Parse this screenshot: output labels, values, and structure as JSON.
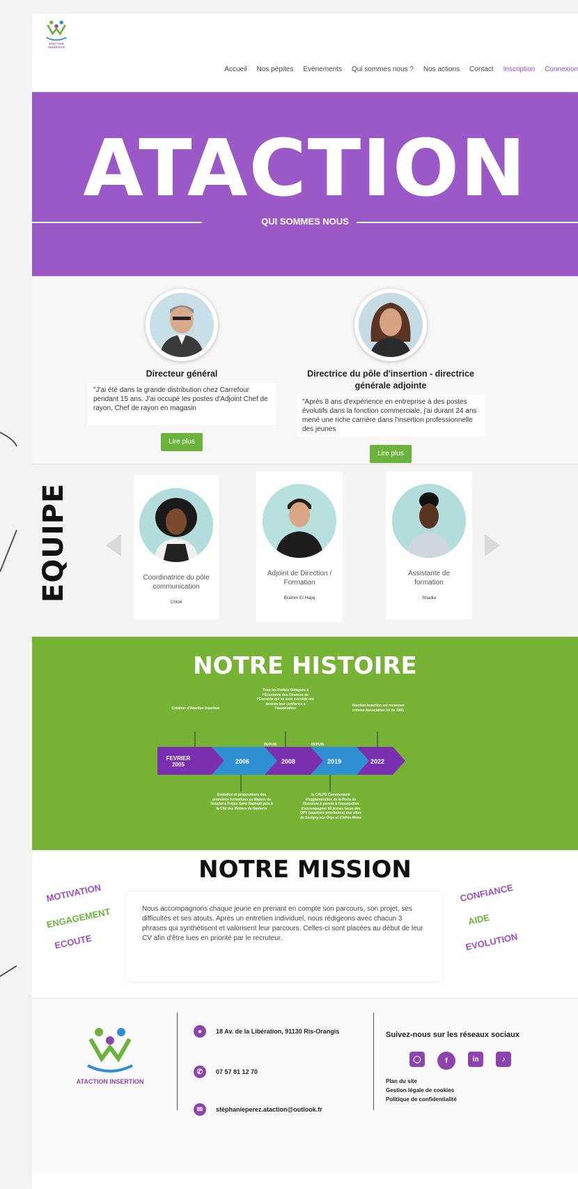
{
  "header": {
    "logo_caption": "ATACTION INSERTION",
    "nav": [
      "Accueil",
      "Nos pépites",
      "Evènements",
      "Qui sommes nous ?",
      "Nos actions",
      "Contact",
      "Inscription",
      "Connexion"
    ]
  },
  "hero": {
    "title": "ATACTION",
    "subtitle": "QUI SOMMES NOUS"
  },
  "directors": [
    {
      "title": "Directeur général",
      "quote": "\"J'ai été dans la grande distribution chez Carrefour pendant 15 ans. J'ai occupé les postes d'Adjoint Chef de rayon, Chef de rayon en magasin",
      "button": "Lire plus"
    },
    {
      "title": "Directrice du pôle d'insertion - directrice générale adjointe",
      "quote": "\"Après 8 ans d'expérience en entreprise à des postes évolutifs dans la fonction commerciale, j'ai durant 24 ans mené une riche carrière dans l'insertion professionnelle des jeunes",
      "button": "Lire plus"
    }
  ],
  "team": {
    "label": "EQUIPE",
    "members": [
      {
        "role": "Coordinatrice du pôle communication",
        "name": "Chloé"
      },
      {
        "role": "Adjoint de Direction / Formation",
        "name": "Brahim El Hajaj"
      },
      {
        "role": "Assistante de formation",
        "name": "Shadia"
      }
    ]
  },
  "histoire": {
    "title": "NOTRE HISTOIRE",
    "segments": [
      {
        "label": "FEVRIER 2005",
        "prefix": ""
      },
      {
        "label": "2006",
        "prefix": ""
      },
      {
        "label": "2008",
        "prefix": "DEPUIS"
      },
      {
        "label": "2019",
        "prefix": "DEPUIS"
      },
      {
        "label": "2022",
        "prefix": ""
      }
    ],
    "notes_top": [
      "Création d'Ataction Insertion",
      "Tous les Préfets Délégués à l'Économie des Chances de l'Essonne qui se sont succédé ont donnés leur confiance à l'association",
      "Ataction Insertion est reconnue comme Association loi de 1901"
    ],
    "notes_bottom": [
      "Evolution et propositions des premières formations au Maison de l'emploi à Fréjus Saint Raphaël puis à la Cité des Métiers de Nanterre",
      "la CALPE Communauté d'agglomération de la Porte de l'Essonne à permis à l'association d'accompagner 90 jeunes issus des QPV (quartiers prioritaires) des villes de Savigny-sur-Orge et d'Athis-Mons"
    ]
  },
  "mission": {
    "title": "NOTRE MISSION",
    "text": "Nous accompagnons chaque jeune en prenant en compte son parcours, son projet, ses difficultés et ses atouts. Après un entretien individuel, nous rédigeons avec chacun 3 phrases qui synthétisent et valorisent leur parcours. Celles-ci sont placées au début de leur CV afin d'être lues en priorité par le recruteur.",
    "values_left": [
      "MOTIVATION",
      "ENGAGEMENT",
      "ECOUTE"
    ],
    "values_right": [
      "CONFIANCE",
      "AIDE",
      "EVOLUTION"
    ]
  },
  "footer": {
    "logo_caption": "ATACTION INSERTION",
    "address": "18 Av. de la Libération, 91130 Ris-Orangis",
    "phone": "07 57 81 12 70",
    "email": "stéphanieperez.ataction@outlook.fr",
    "social_title": "Suivez-nous sur les réseaux sociaux",
    "socials": [
      "instagram-icon",
      "facebook-icon",
      "linkedin-icon",
      "tiktok-icon"
    ],
    "links": [
      "Plan du site",
      "Gestion légale de cookies",
      "Politique de confidentialité"
    ]
  },
  "colors": {
    "purple": "#9a59c6",
    "green": "#76b233",
    "button_green": "#6cb33e",
    "timeline_blue": "#2e8fd3",
    "timeline_purple": "#7a2fb0"
  }
}
